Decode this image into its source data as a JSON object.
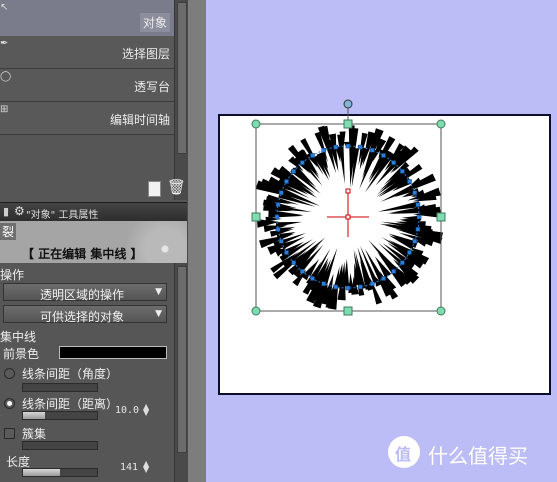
{
  "sub_tool_list": {
    "items": [
      {
        "label": "对象",
        "icon": "pointer-icon",
        "selected": true
      },
      {
        "label": "选择图层",
        "icon": "pen-icon"
      },
      {
        "label": "透写台",
        "icon": "bulb-icon"
      },
      {
        "label": "编辑时间轴",
        "icon": "plus-icon"
      }
    ]
  },
  "panel": {
    "title": "\"对象\" 工具属性",
    "banner_char": "裂",
    "editing_label": "【 正在编辑 集中线 】"
  },
  "properties": {
    "operation_section": "操作",
    "dropdown_transparent": "透明区域的操作",
    "dropdown_selectable": "可供选择的对象",
    "focus_lines_section": "集中线",
    "foreground_label": "前景色",
    "foreground_color": "#000000",
    "spacing_angle_label": "线条间距（角度）",
    "spacing_distance_label": "线条间距（距离）",
    "spacing_distance_value": "10.0",
    "bundle_label": "簇集",
    "length_label": "长度",
    "length_value": "141"
  },
  "watermark": {
    "logo_char": "值",
    "text": "什么值得买"
  },
  "colors": {
    "workspace_bg": "#bcbcf6",
    "panel_bg": "#565656",
    "selection_handle": "#7fdcb0",
    "control_point": "#2a7fd9",
    "center_marker": "#cc0000"
  }
}
